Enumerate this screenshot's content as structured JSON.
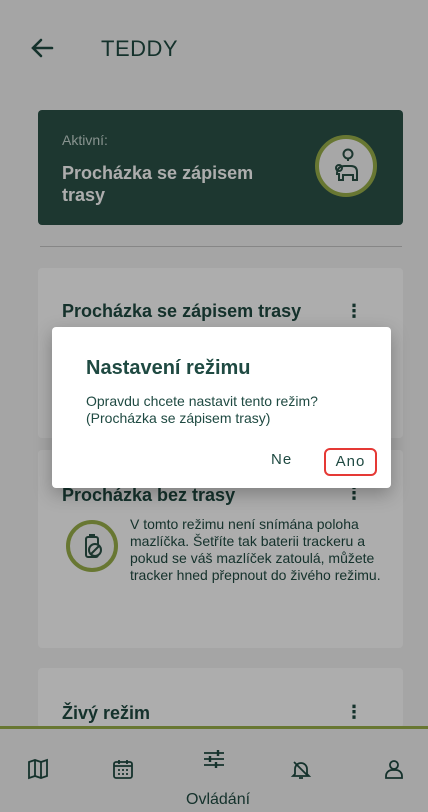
{
  "header": {
    "title": "TEDDY",
    "back_icon": "arrow-left-icon"
  },
  "active_card": {
    "label": "Aktivní:",
    "mode": "Procházka se zápisem trasy",
    "icon": "pet-location-icon"
  },
  "modes": [
    {
      "title": "Procházka se zápisem trasy",
      "menu": "⋮"
    },
    {
      "title": "Procházka bez trasy",
      "menu": "⋮",
      "icon": "battery-off-icon",
      "description": "V tomto režimu není snímána poloha mazlíčka. Šetříte tak baterii trackeru a pokud se váš mazlíček zatoulá, můžete tracker hned přepnout do živého režimu."
    },
    {
      "title": "Živý režim",
      "menu": "⋮"
    }
  ],
  "dialog": {
    "title": "Nastavení režimu",
    "text": "Opravdu chcete nastavit tento režim? (Procházka se zápisem trasy)",
    "cancel": "Ne",
    "confirm": "Ano"
  },
  "bottom_nav": {
    "active_label": "Ovládání",
    "items": [
      "map-icon",
      "calendar-icon",
      "controls-icon",
      "alarm-icon",
      "profile-icon"
    ]
  },
  "colors": {
    "primary": "#2b5248",
    "accent": "#9ab04a",
    "highlight": "#e53935"
  }
}
